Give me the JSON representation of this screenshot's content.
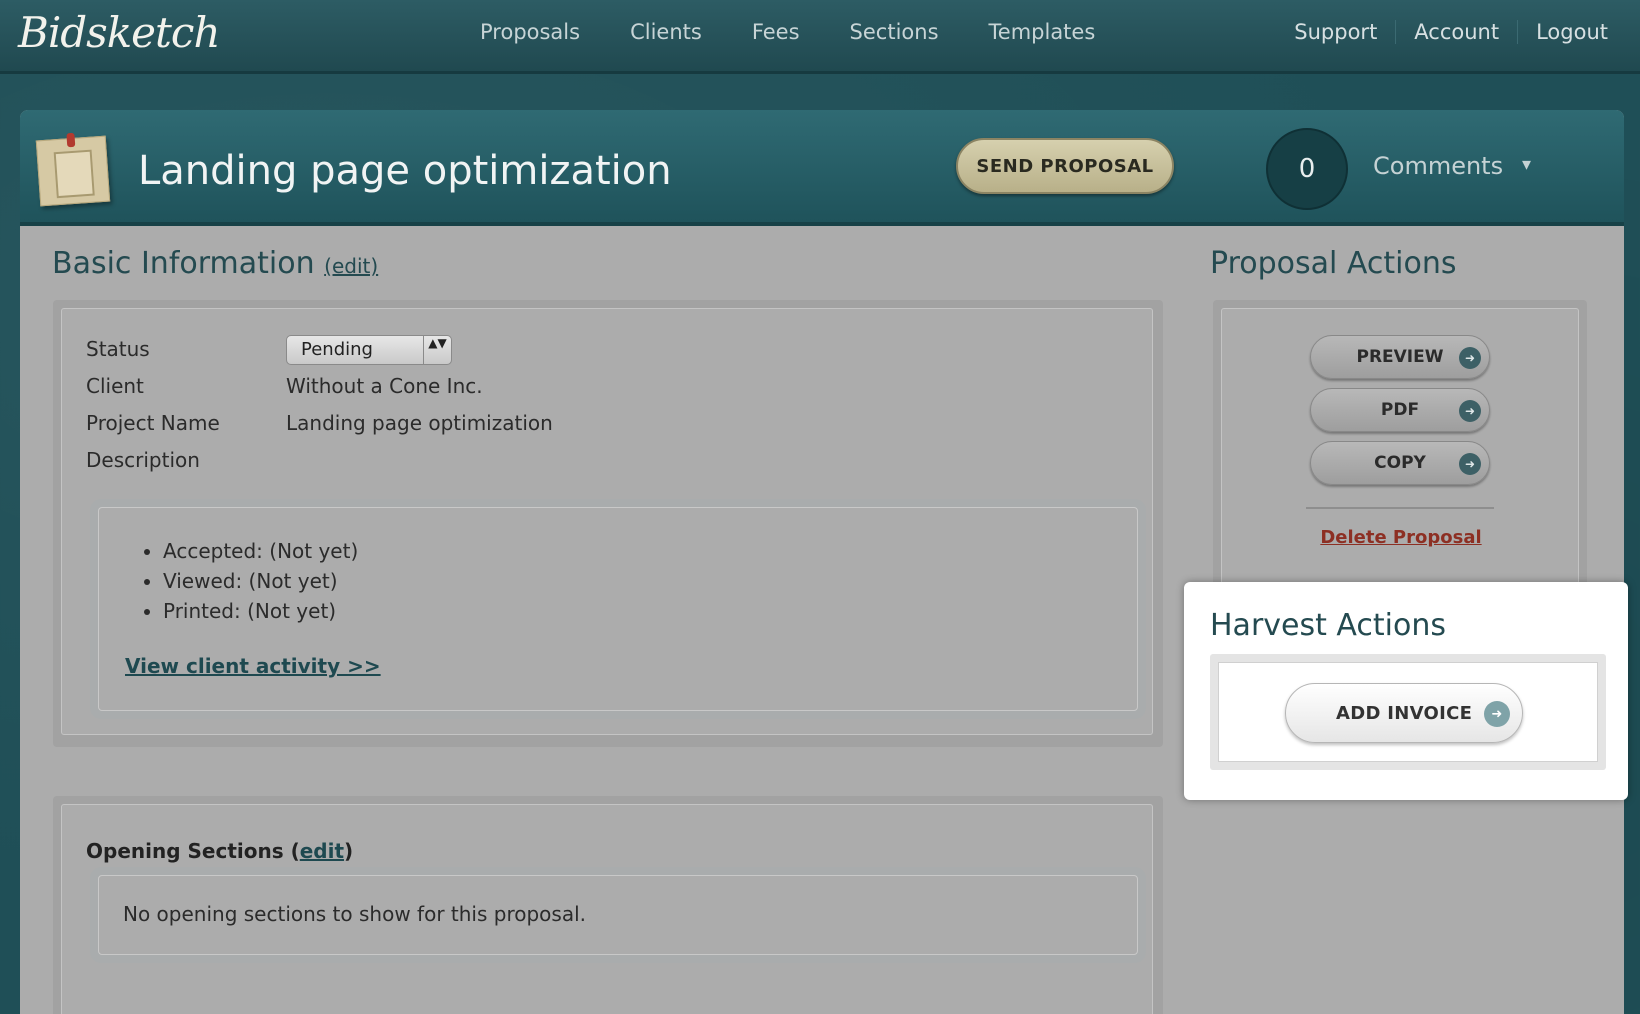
{
  "app": {
    "logo": "Bidsketch"
  },
  "nav": {
    "main": [
      "Proposals",
      "Clients",
      "Fees",
      "Sections",
      "Templates"
    ],
    "right": [
      "Support",
      "Account",
      "Logout"
    ]
  },
  "proposal": {
    "title": "Landing page optimization",
    "send_label": "SEND PROPOSAL",
    "comment_count": "0",
    "comments_label": "Comments",
    "comments_arrow": "▾"
  },
  "basic_info": {
    "heading": "Basic Information",
    "edit_label": "(edit)",
    "status_label": "Status",
    "status_value": "Pending",
    "select_arrows": "▲▼",
    "client_label": "Client",
    "client_value": "Without a Cone Inc.",
    "project_label": "Project Name",
    "project_value": "Landing page optimization",
    "description_label": "Description",
    "activity": [
      "Accepted: (Not yet)",
      "Viewed: (Not yet)",
      "Printed: (Not yet)"
    ],
    "activity_link": "View client activity >>"
  },
  "opening_sections": {
    "title": "Opening Sections",
    "edit_label": "edit",
    "empty_message": "No opening sections to show for this proposal."
  },
  "proposal_actions": {
    "heading": "Proposal Actions",
    "buttons": [
      "PREVIEW",
      "PDF",
      "COPY"
    ],
    "arrow": "➜",
    "delete_label": "Delete Proposal"
  },
  "harvest_actions": {
    "heading": "Harvest Actions",
    "add_invoice_label": "ADD INVOICE",
    "arrow": "➜"
  }
}
